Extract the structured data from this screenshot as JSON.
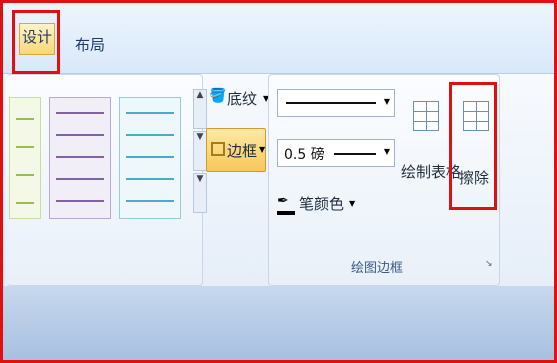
{
  "tabs": [
    {
      "label": "设计"
    },
    {
      "label": "布局"
    }
  ],
  "ribbon": {
    "shading_label": "底纹",
    "borders_label": "边框",
    "line_weight": "0.5 磅",
    "pen_color_label": "笔颜色",
    "draw_table_label": "绘制表格",
    "eraser_label": "擦除",
    "group_title": "绘图边框"
  },
  "colors": {
    "highlight": "#e01010",
    "tab_active": "#f9d677",
    "ribbon_bg": "#e6eef8"
  }
}
